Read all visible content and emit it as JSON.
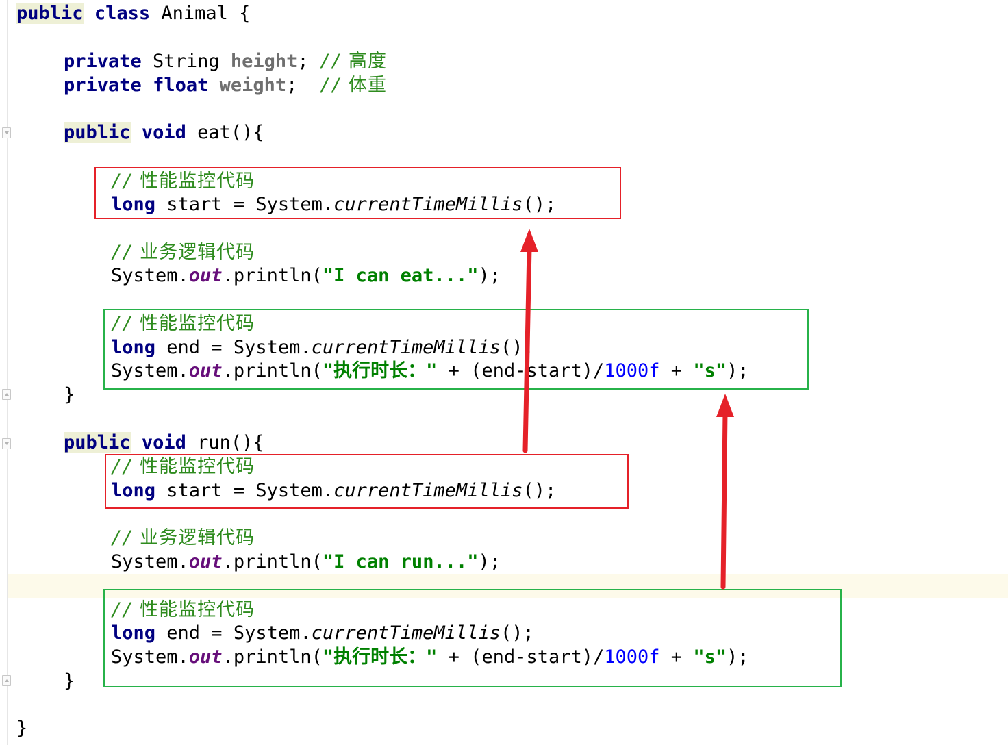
{
  "editor": {
    "lines": [
      {
        "tokens": [
          {
            "t": "public",
            "c": "kw-hl"
          },
          {
            "t": " "
          },
          {
            "t": "class",
            "c": "kw"
          },
          {
            "t": " Animal {"
          }
        ]
      },
      {
        "tokens": [
          {
            "t": "private",
            "c": "kw"
          },
          {
            "t": " String "
          },
          {
            "t": "height",
            "c": "fld"
          },
          {
            "t": "; "
          },
          {
            "t": "//",
            "c": "cmt-slash"
          },
          {
            "t": " 高度",
            "c": "cmt"
          }
        ]
      },
      {
        "tokens": [
          {
            "t": "private",
            "c": "kw"
          },
          {
            "t": " "
          },
          {
            "t": "float",
            "c": "kw"
          },
          {
            "t": " "
          },
          {
            "t": "weight",
            "c": "fld"
          },
          {
            "t": ";  "
          },
          {
            "t": "//",
            "c": "cmt-slash"
          },
          {
            "t": " 体重",
            "c": "cmt"
          }
        ]
      },
      {
        "tokens": [
          {
            "t": "public",
            "c": "kw-hl"
          },
          {
            "t": " "
          },
          {
            "t": "void",
            "c": "kw"
          },
          {
            "t": " eat(){"
          }
        ]
      },
      {
        "tokens": [
          {
            "t": "//",
            "c": "cmt-slash"
          },
          {
            "t": " 性能监控代码",
            "c": "cmt"
          }
        ]
      },
      {
        "tokens": [
          {
            "t": "long",
            "c": "kw"
          },
          {
            "t": " start = System."
          },
          {
            "t": "currentTimeMillis",
            "c": "meth"
          },
          {
            "t": "();"
          }
        ]
      },
      {
        "tokens": [
          {
            "t": "//",
            "c": "cmt-slash"
          },
          {
            "t": " 业务逻辑代码",
            "c": "cmt"
          }
        ]
      },
      {
        "tokens": [
          {
            "t": "System."
          },
          {
            "t": "out",
            "c": "static"
          },
          {
            "t": ".println("
          },
          {
            "t": "\"I can eat...\"",
            "c": "str"
          },
          {
            "t": ");"
          }
        ]
      },
      {
        "tokens": [
          {
            "t": "//",
            "c": "cmt-slash"
          },
          {
            "t": " 性能监控代码",
            "c": "cmt"
          }
        ]
      },
      {
        "tokens": [
          {
            "t": "long",
            "c": "kw"
          },
          {
            "t": " end = System."
          },
          {
            "t": "currentTimeMillis",
            "c": "meth"
          },
          {
            "t": "();"
          }
        ]
      },
      {
        "tokens": [
          {
            "t": "System."
          },
          {
            "t": "out",
            "c": "static"
          },
          {
            "t": ".println("
          },
          {
            "t": "\"执行时长：\"",
            "c": "str"
          },
          {
            "t": " + (end-start)/"
          },
          {
            "t": "1000f",
            "c": "num"
          },
          {
            "t": " + "
          },
          {
            "t": "\"s\"",
            "c": "str"
          },
          {
            "t": ");"
          }
        ]
      },
      {
        "tokens": [
          {
            "t": "}"
          }
        ]
      },
      {
        "tokens": [
          {
            "t": "public",
            "c": "kw-hl"
          },
          {
            "t": " "
          },
          {
            "t": "void",
            "c": "kw"
          },
          {
            "t": " run(){"
          }
        ]
      },
      {
        "tokens": [
          {
            "t": "//",
            "c": "cmt-slash"
          },
          {
            "t": " 性能监控代码",
            "c": "cmt"
          }
        ]
      },
      {
        "tokens": [
          {
            "t": "long",
            "c": "kw"
          },
          {
            "t": " start = System."
          },
          {
            "t": "currentTimeMillis",
            "c": "meth"
          },
          {
            "t": "();"
          }
        ]
      },
      {
        "tokens": [
          {
            "t": "//",
            "c": "cmt-slash"
          },
          {
            "t": " 业务逻辑代码",
            "c": "cmt"
          }
        ]
      },
      {
        "tokens": [
          {
            "t": "System."
          },
          {
            "t": "out",
            "c": "static"
          },
          {
            "t": ".println("
          },
          {
            "t": "\"I can run...\"",
            "c": "str"
          },
          {
            "t": ");"
          }
        ]
      },
      {
        "tokens": [
          {
            "t": "//",
            "c": "cmt-slash"
          },
          {
            "t": " 性能监控代码",
            "c": "cmt"
          }
        ]
      },
      {
        "tokens": [
          {
            "t": "long",
            "c": "kw"
          },
          {
            "t": " end = System."
          },
          {
            "t": "currentTimeMillis",
            "c": "meth"
          },
          {
            "t": "();"
          }
        ]
      },
      {
        "tokens": [
          {
            "t": "System."
          },
          {
            "t": "out",
            "c": "static"
          },
          {
            "t": ".println("
          },
          {
            "t": "\"执行时长：\"",
            "c": "str"
          },
          {
            "t": " + (end-start)/"
          },
          {
            "t": "1000f",
            "c": "num"
          },
          {
            "t": " + "
          },
          {
            "t": "\"s\"",
            "c": "str"
          },
          {
            "t": ");"
          }
        ]
      },
      {
        "tokens": [
          {
            "t": "}"
          }
        ]
      },
      {
        "tokens": [
          {
            "t": "}"
          }
        ]
      }
    ]
  },
  "annotations": {
    "box_color_red": "#e52129",
    "box_color_green": "#27b24a",
    "arrow_color": "#e52129",
    "arrow_icon": "arrow-up-icon"
  },
  "colors": {
    "keyword": "#000080",
    "field": "#6f6f6f",
    "comment": "#2e8b1e",
    "string": "#008000",
    "number": "#0000ff",
    "static_field": "#660e7a",
    "caret_row": "#fdfaea"
  }
}
